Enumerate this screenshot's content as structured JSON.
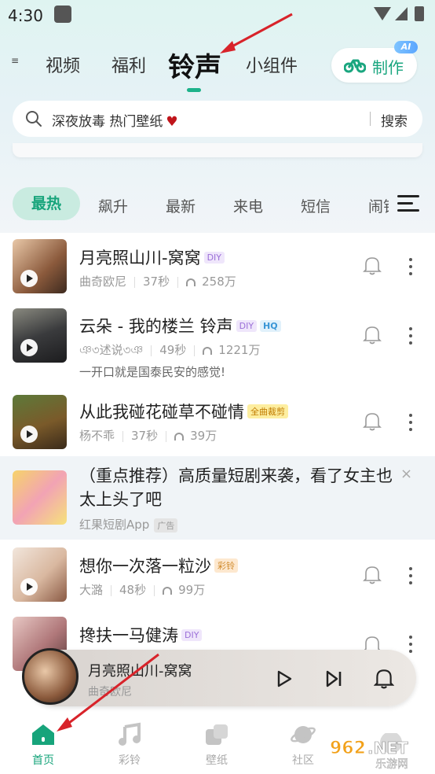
{
  "status_bar": {
    "time": "4:30"
  },
  "top_tabs": [
    "视频",
    "福利",
    "铃声",
    "小组件"
  ],
  "make_button": {
    "label": "制作",
    "badge": "AI"
  },
  "search": {
    "placeholder": "深夜放毒 热门壁纸",
    "button": "搜索"
  },
  "categories": [
    "最热",
    "飙升",
    "最新",
    "来电",
    "短信",
    "闹钟"
  ],
  "songs": [
    {
      "title": "月亮照山川-窝窝",
      "tags": [
        "DIY"
      ],
      "artist": "曲奇欧尼",
      "duration": "37秒",
      "plays": "258万",
      "desc": ""
    },
    {
      "title": "云朵 - 我的楼兰 铃声",
      "tags": [
        "DIY",
        "HQ"
      ],
      "artist": "ঞ৩述说৩ঞ",
      "duration": "49秒",
      "plays": "1221万",
      "desc": "一开口就是国泰民安的感觉!"
    },
    {
      "title": "从此我碰花碰草不碰情",
      "tags": [
        "全曲裁剪"
      ],
      "artist": "杨不乖",
      "duration": "37秒",
      "plays": "39万",
      "desc": ""
    },
    {
      "title": "想你一次落一粒沙",
      "tags": [
        "彩铃"
      ],
      "artist": "大潞",
      "duration": "48秒",
      "plays": "99万",
      "desc": ""
    },
    {
      "title": "搀扶一马健涛",
      "tags": [
        "DIY"
      ],
      "artist": "",
      "duration": "",
      "plays": "",
      "desc": ""
    }
  ],
  "ad": {
    "title": "（重点推荐）高质量短剧来袭，看了女主也太上头了吧",
    "source": "红果短剧App",
    "badge": "广告",
    "close": "×"
  },
  "player": {
    "title": "月亮照山川-窝窝",
    "artist": "曲奇欧尼"
  },
  "bottom_nav": [
    "首页",
    "彩铃",
    "壁纸",
    "社区"
  ],
  "watermark": {
    "brand": "962.NET",
    "sub": "乐游网"
  },
  "colors": {
    "accent": "#17a47b",
    "tab_active_bg": "#c9ebe0"
  }
}
